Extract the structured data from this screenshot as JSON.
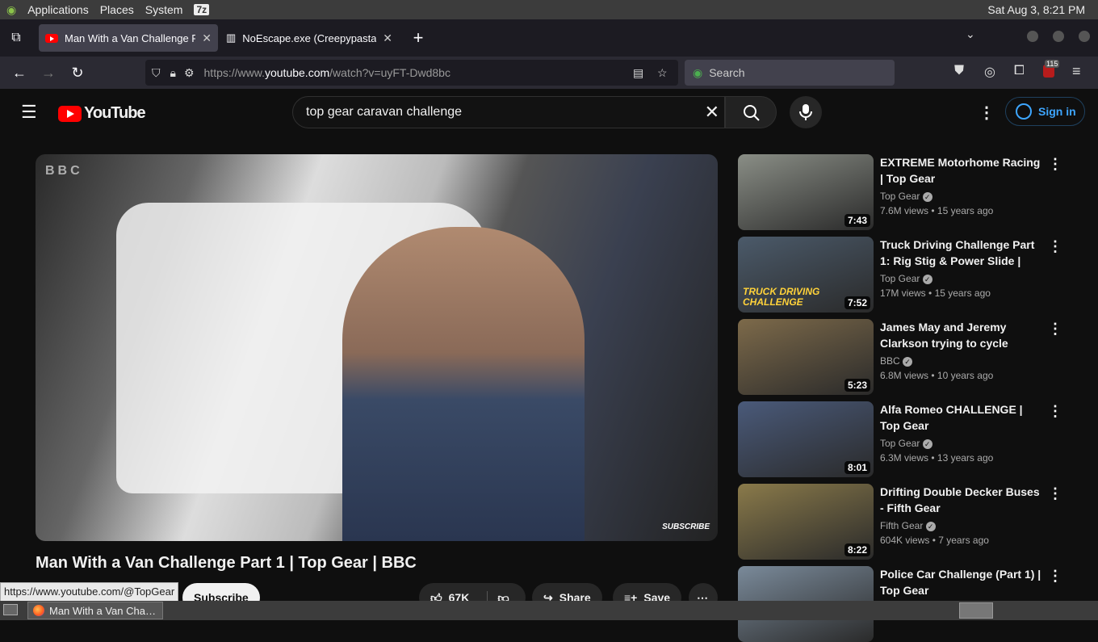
{
  "system": {
    "applications": "Applications",
    "places": "Places",
    "system": "System",
    "badge": "7z",
    "clock": "Sat Aug  3,  8:21 PM"
  },
  "tabs": [
    {
      "title": "Man With a Van Challenge P",
      "active": true
    },
    {
      "title": "NoEscape.exe (Creepypasta",
      "active": false
    }
  ],
  "nav": {
    "url_prefix": "https://www.",
    "url_domain": "youtube.com",
    "url_suffix": "/watch?v=uyFT-Dwd8bc",
    "search_placeholder": "Search",
    "ext_badge": "115"
  },
  "yt": {
    "logo": "YouTube",
    "query": "top gear caravan challenge",
    "sign_in": "Sign in"
  },
  "video": {
    "watermark": "BBC",
    "subscribe_overlay": "SUBSCRIBE",
    "title": "Man With a Van Challenge Part 1 | Top Gear | BBC",
    "subscribe": "Subscribe",
    "likes": "67K",
    "share": "Share",
    "save": "Save"
  },
  "recommendations": [
    {
      "title": "EXTREME Motorhome Racing | Top Gear",
      "channel": "Top Gear",
      "views": "7.6M views",
      "age": "15 years ago",
      "duration": "7:43",
      "bg": "#8a8e86"
    },
    {
      "title": "Truck Driving Challenge Part 1: Rig Stig & Power Slide | Top…",
      "channel": "Top Gear",
      "views": "17M views",
      "age": "15 years ago",
      "duration": "7:52",
      "bg": "#4b5a6a",
      "overlay": "TRUCK DRIVING CHALLENGE"
    },
    {
      "title": "James May and Jeremy Clarkson trying to cycle aroun…",
      "channel": "BBC",
      "views": "6.8M views",
      "age": "10 years ago",
      "duration": "5:23",
      "bg": "#7d6a4a"
    },
    {
      "title": "Alfa Romeo CHALLENGE | Top Gear",
      "channel": "Top Gear",
      "views": "6.3M views",
      "age": "13 years ago",
      "duration": "8:01",
      "bg": "#4a5a7a"
    },
    {
      "title": "Drifting Double Decker Buses - Fifth Gear",
      "channel": "Fifth Gear",
      "views": "604K views",
      "age": "7 years ago",
      "duration": "8:22",
      "bg": "#8a7a4a"
    },
    {
      "title": "Police Car Challenge (Part 1) | Top Gear",
      "channel": "",
      "views": "",
      "age": "",
      "duration": "",
      "bg": "#7a8a9a"
    }
  ],
  "status_url": "https://www.youtube.com/@TopGear",
  "taskbar": {
    "item": "Man With a Van Cha…"
  }
}
